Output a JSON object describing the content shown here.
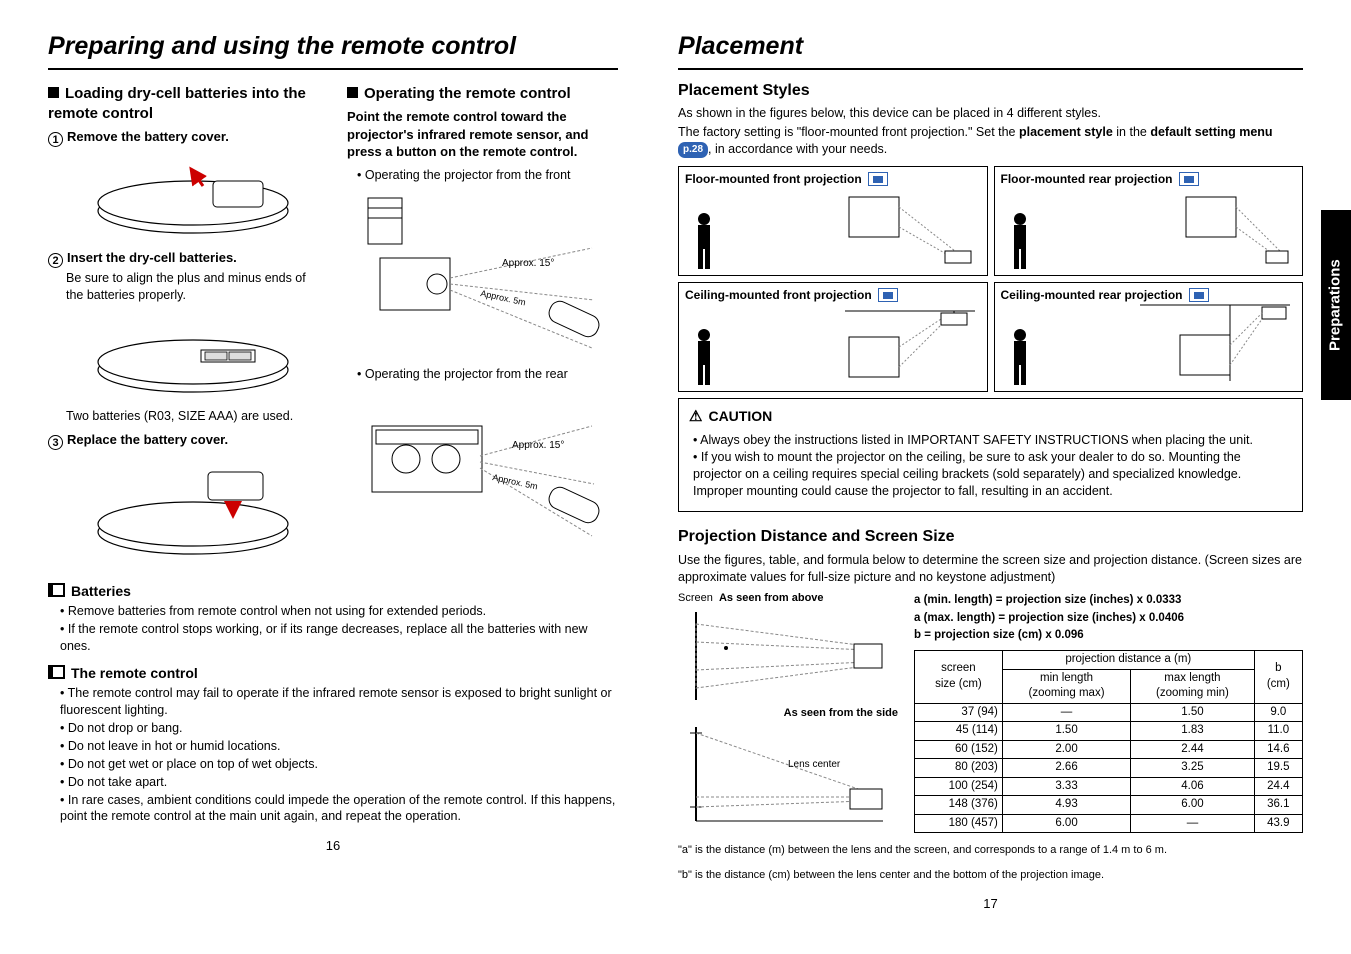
{
  "left_page": {
    "title": "Preparing and using the remote control",
    "loading_heading": "Loading dry-cell batteries into the remote control",
    "step1_label": "Remove the battery cover.",
    "step2_label": "Insert the dry-cell batteries.",
    "step2_desc": "Be sure to align the plus and minus ends of the batteries properly.",
    "step2_note": "Two batteries (R03, SIZE AAA) are used.",
    "step3_label": "Replace the battery cover.",
    "operating_heading": "Operating the remote control",
    "operating_lead": "Point the remote control toward the projector's infrared remote sensor, and press a button on the remote control.",
    "front_caption": "Operating the projector from the front",
    "rear_caption": "Operating the projector from the rear",
    "angle_label": "Approx. 15°",
    "distance_label": "Approx. 5m",
    "batteries_head": "Batteries",
    "batteries_notes": [
      "Remove batteries from remote control when not using for extended periods.",
      "If the remote control stops working, or if its range decreases, replace all the batteries with new ones."
    ],
    "remote_head": "The remote control",
    "remote_notes": [
      "The remote control may fail to operate if the infrared remote sensor is exposed to bright sunlight or fluorescent lighting.",
      "Do not drop or bang.",
      "Do not leave in hot or humid locations.",
      "Do not get wet or place on top of wet objects.",
      "Do not take apart.",
      "In rare cases, ambient conditions could impede the operation of the remote control. If this happens, point the remote control at the main unit again, and repeat the operation."
    ],
    "page_number": "16"
  },
  "right_page": {
    "title": "Placement",
    "styles_head": "Placement Styles",
    "styles_intro1": "As shown in the figures below, this device can be placed in 4 different styles.",
    "styles_intro2_a": "The factory setting is \"floor-mounted front projection.\" Set the ",
    "styles_intro2_b": "placement style",
    "styles_intro2_c": " in the ",
    "styles_intro2_d": "default setting menu ",
    "styles_intro2_e": ", in accordance with your needs.",
    "pref_label": "p.28",
    "placement_names": [
      "Floor-mounted front projection",
      "Floor-mounted rear projection",
      "Ceiling-mounted front projection",
      "Ceiling-mounted rear projection"
    ],
    "caution_head": "CAUTION",
    "caution_items": [
      "Always obey the instructions listed in IMPORTANT SAFETY INSTRUCTIONS when placing the unit.",
      "If you wish to mount the projector on the ceiling, be sure to ask your dealer to do so. Mounting the projector on a ceiling requires special ceiling brackets (sold separately) and specialized knowledge. Improper mounting could cause the projector to fall, resulting in an accident."
    ],
    "proj_head": "Projection Distance and Screen Size",
    "proj_intro": "Use the figures, table, and formula below to determine the screen size and projection distance. (Screen sizes are approximate values for full-size picture and no keystone adjustment)",
    "screen_label": "Screen",
    "top_view_label": "As seen from above",
    "side_view_label": "As seen from the side",
    "lens_center_label": "Lens center",
    "formula_a_min": "a (min. length) = projection size (inches) x 0.0333",
    "formula_a_max": "a (max. length) = projection size (inches) x 0.0406",
    "formula_b": "b = projection size (cm) x 0.096",
    "table_headers": {
      "screen": "screen\nsize (cm)",
      "proj_dist": "projection distance a (m)",
      "min": "min length\n(zooming max)",
      "max": "max length\n(zooming min)",
      "b": "b\n(cm)"
    },
    "footnote_a": "\"a\" is the distance (m) between the lens and the screen, and corresponds to a range of 1.4 m to 6 m.",
    "footnote_b": "\"b\" is the distance (cm) between the lens center and the bottom of the projection image.",
    "side_tab": "Preparations",
    "page_number": "17"
  },
  "chart_data": {
    "type": "table",
    "title": "Projection distance and screen size",
    "columns": [
      "screen size (cm)",
      "min length (zooming max) a (m)",
      "max length (zooming min) a (m)",
      "b (cm)"
    ],
    "rows": [
      {
        "screen": "37   (94)",
        "min": "—",
        "max": "1.50",
        "b": "9.0"
      },
      {
        "screen": "45 (114)",
        "min": "1.50",
        "max": "1.83",
        "b": "11.0"
      },
      {
        "screen": "60 (152)",
        "min": "2.00",
        "max": "2.44",
        "b": "14.6"
      },
      {
        "screen": "80 (203)",
        "min": "2.66",
        "max": "3.25",
        "b": "19.5"
      },
      {
        "screen": "100 (254)",
        "min": "3.33",
        "max": "4.06",
        "b": "24.4"
      },
      {
        "screen": "148 (376)",
        "min": "4.93",
        "max": "6.00",
        "b": "36.1"
      },
      {
        "screen": "180 (457)",
        "min": "6.00",
        "max": "—",
        "b": "43.9"
      }
    ]
  }
}
